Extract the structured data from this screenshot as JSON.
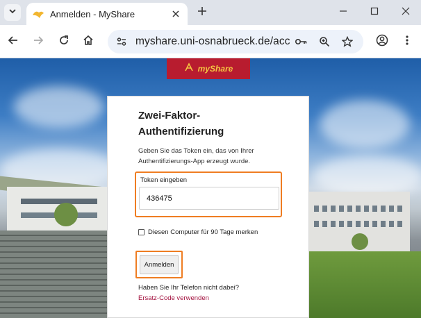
{
  "browser": {
    "tab": {
      "title": "Anmelden - MyShare"
    },
    "url": "myshare.uni-osnabrueck.de/account/login/two-factor/",
    "icons": [
      "tab-list-icon",
      "favicon-icon",
      "close-icon",
      "plus-icon",
      "minimize-icon",
      "maximize-icon",
      "window-close-icon",
      "back-arrow-icon",
      "forward-arrow-icon",
      "reload-icon",
      "home-icon",
      "site-info-icon",
      "password-key-icon",
      "zoom-icon",
      "star-icon",
      "profile-icon",
      "more-vert-icon"
    ]
  },
  "page": {
    "logo": {
      "text": "myShare",
      "bg_color": "#b81c2f",
      "text_color": "#f4c341"
    },
    "card": {
      "title": "Zwei-Faktor-Authentifizierung",
      "description": "Geben Sie das Token ein, das von Ihrer Authentifizierungs-App erzeugt wurde.",
      "token_label": "Token eingeben",
      "token_value": "436475",
      "remember_label": "Diesen Computer für 90 Tage merken",
      "remember_checked": false,
      "submit_label": "Anmelden",
      "phone_question": "Haben Sie Ihr Telefon nicht dabei?",
      "backup_link": "Ersatz-Code verwenden",
      "highlight_color": "#ef7d22",
      "link_color": "#a3123f"
    }
  }
}
